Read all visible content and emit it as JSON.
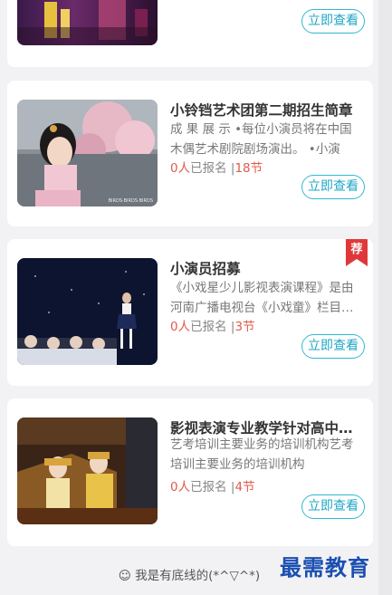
{
  "cards": [
    {
      "title": "",
      "desc": "",
      "button": "立即查看"
    },
    {
      "title": "小铃铛艺术团第二期招生简章",
      "desc": "成 果 展 示 •每位小演员将在中国木偶艺术剧院剧场演出。 •小演员…",
      "count": "0人",
      "count_suffix": "已报名",
      "sep": " |",
      "lessons": "18节",
      "button": "立即查看"
    },
    {
      "title": "小演员招募",
      "desc": "《小戏星少儿影视表演课程》是由河南广播电视台《小戏童》栏目…",
      "count": "0人",
      "count_suffix": "已报名",
      "sep": " |",
      "lessons": "3节",
      "button": "立即查看",
      "badge": "荐"
    },
    {
      "title": "影视表演专业教学针对高中…",
      "desc": "艺考培训主要业务的培训机构艺考培训主要业务的培训机构",
      "count": "0人",
      "count_suffix": "已报名",
      "sep": " |",
      "lessons": "4节",
      "button": "立即查看"
    }
  ],
  "footer": "☺ 我是有底线的(*^▽^*)",
  "watermark": "最需教育",
  "colors": {
    "accent": "#32b7d3",
    "count_red": "#e05a4b",
    "badge_red": "#e0383a"
  }
}
